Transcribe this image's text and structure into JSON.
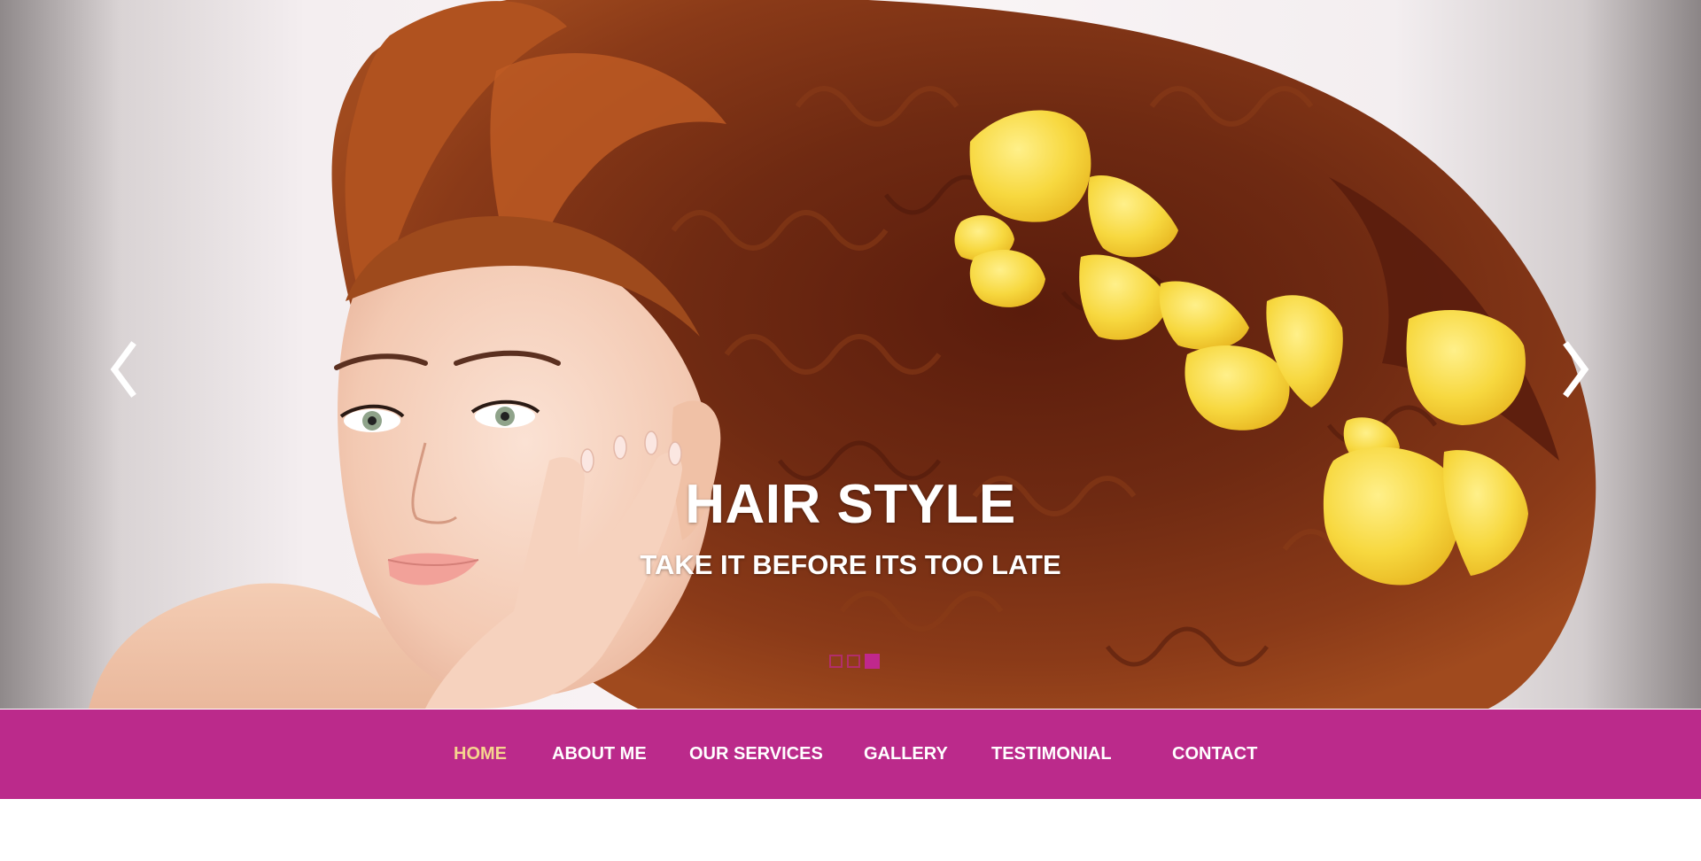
{
  "slider": {
    "title": "HAIR STYLE",
    "subtitle": "TAKE IT BEFORE ITS TOO LATE",
    "prev_icon": "chevron-left-icon",
    "next_icon": "chevron-right-icon",
    "slide_count": 3,
    "active_slide": 3
  },
  "nav": {
    "items": [
      {
        "label": "HOME",
        "active": true
      },
      {
        "label": "ABOUT ME",
        "active": false
      },
      {
        "label": "OUR SERVICES",
        "active": false
      },
      {
        "label": "GALLERY",
        "active": false
      },
      {
        "label": "TESTIMONIAL",
        "active": false
      },
      {
        "label": "CONTACT",
        "active": false
      }
    ]
  },
  "colors": {
    "nav_background": "#bb2a8b",
    "nav_active_text": "#f6d48e",
    "nav_text": "#ffffff",
    "indicator": "#c0288c",
    "caption_text": "#ffffff",
    "petal_yellow": "#f6d640",
    "hair_brown": "#6e2a12"
  }
}
